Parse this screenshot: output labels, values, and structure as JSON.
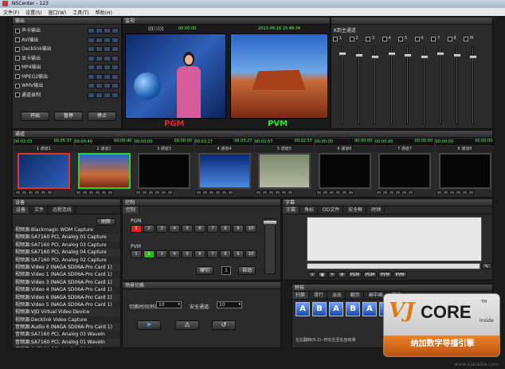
{
  "window": {
    "title": "NSCenter - 123"
  },
  "menu": [
    "文件(F)",
    "设置(S)",
    "窗口(W)",
    "工具(T)",
    "帮助(H)"
  ],
  "output": {
    "title": "输出",
    "items": [
      "声卡输出",
      "AVI输出",
      "Decklink输出",
      "显卡输出",
      "MP4输出",
      "MPEG2输出",
      "WMV输出",
      "通道录制"
    ],
    "start": "开始",
    "pause": "暂停",
    "stop": "停止"
  },
  "monitor": {
    "title": "监视",
    "pgm_label": "PGM",
    "pvm_label": "PVM",
    "pgm_time": "00:00:00",
    "pvm_date": "2013-08-16 15:48:34",
    "pgm_badge": "(((⚆)))"
  },
  "mixer": {
    "title": "",
    "label": "K到主通道",
    "channels": [
      "1",
      "2",
      "3",
      "4",
      "5",
      "6",
      "7",
      "8",
      "M"
    ]
  },
  "channels": {
    "title": "通道",
    "items": [
      {
        "t1": "00:02:03",
        "t2": "00:05:37",
        "name": "1 通道1"
      },
      {
        "t1": "00:00:40",
        "t2": "00:00:40",
        "name": "2 通道2"
      },
      {
        "t1": "00:00:00",
        "t2": "00:00:00",
        "name": "3 通道3"
      },
      {
        "t1": "00:03:27",
        "t2": "00:03:27",
        "name": "4 通道4"
      },
      {
        "t1": "00:02:57",
        "t2": "00:02:57",
        "name": "5 通道5"
      },
      {
        "t1": "00:00:00",
        "t2": "00:00:00",
        "name": "6 通道6"
      },
      {
        "t1": "00:00:00",
        "t2": "00:00:00",
        "name": "7 通道7"
      },
      {
        "t1": "00:00:00",
        "t2": "00:00:00",
        "name": "8 通道8"
      }
    ]
  },
  "devices": {
    "title": "设备",
    "tabs": [
      "设备",
      "文件",
      "远程连线"
    ],
    "refresh": "刷新",
    "list": [
      "视频源:Blackmagic WDM Capture",
      "视频源:SA7160 PCI, Analog 01 Capture",
      "视频源:SA7160 PCI, Analog 03 Capture",
      "视频源:SA7160 PCI, Analog 04 Capture",
      "视频源:SA7160 PCI, Analog 02 Capture",
      "视频源:Video 2 (NAGA SD06A-Pro Card 1)",
      "视频源:Video 1 (NAGA SD06A-Pro Card 1)",
      "视频源:Video 3 (NAGA SD06A-Pro Card 1)",
      "视频源:Video 4 (NAGA SD06A-Pro Card 1)",
      "视频源:Video 6 (NAGA SD06A-Pro Card 1)",
      "视频源:Video 5 (NAGA SD06A-Pro Card 1)",
      "视频源:VJD Virtual Video Device",
      "视频源:Decklink Video Capture",
      "音频源:Audio 6 (NAGA SD06A-Pro Card 1)",
      "音频源:SA7160 PCI, Analog 03 WaveIn",
      "音频源:SA7160 PCI, Analog 01 WaveIn",
      "音频源:SA7160 PCI, Analog 04 WaveIn",
      "音频源:SA7160 PCI, Analog 02 WaveIn"
    ]
  },
  "control": {
    "title": "控制",
    "tab": "控制",
    "pgm": "PGM",
    "pvm": "PVM",
    "buttons": [
      "1",
      "2",
      "3",
      "4",
      "5",
      "6",
      "7",
      "8",
      "9",
      "10"
    ],
    "cut": "硬切",
    "count": "1",
    "auto": "自动"
  },
  "subtitle": {
    "title": "字幕",
    "tabs": [
      "字幕",
      "角标",
      "OD文件",
      "安全框",
      "时钟"
    ],
    "pgm": "PGM",
    "pvm": "PVM"
  },
  "transition": {
    "title": "场景切换",
    "duration_label": "切换时间(秒)",
    "duration_value": "10",
    "channel_label": "安全通道:",
    "channel_value": "10"
  },
  "effects": {
    "title": "特技",
    "tabs": [
      "扫换",
      "滑行",
      "淡出",
      "翻页",
      "画中画",
      "其他"
    ],
    "status": "左右翻转(0:2)--时长左至右自动滑"
  },
  "logo": {
    "vj": "VJ",
    "core": "CORE",
    "inside": "inside",
    "tm": "TM",
    "slogan": "纳加数字导播引擎"
  },
  "watermark": "www.xiazaiba.com"
}
